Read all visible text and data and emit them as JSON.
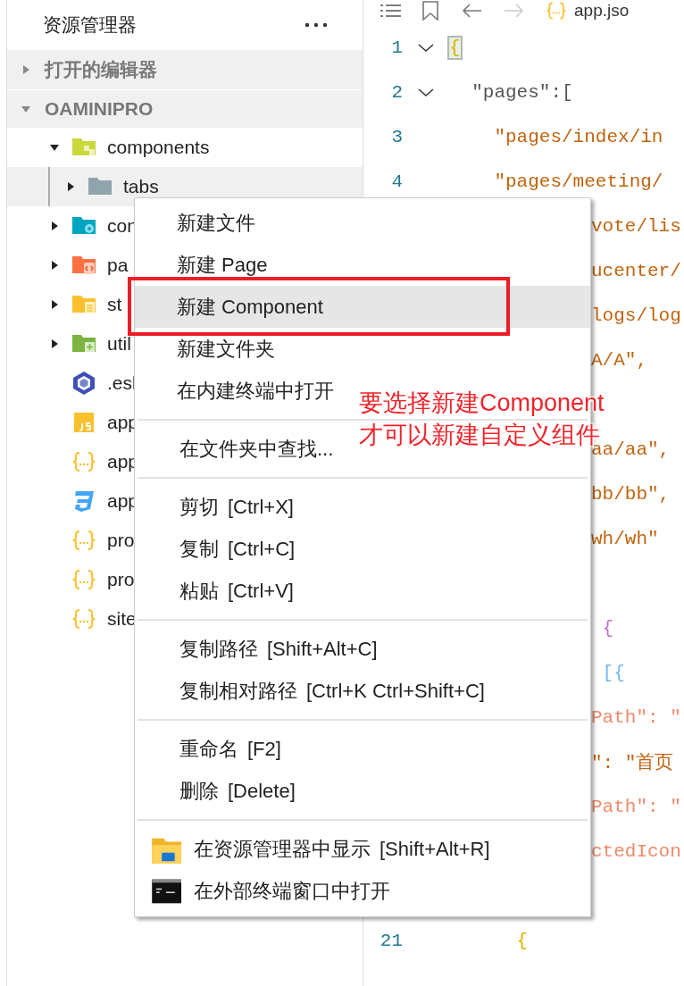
{
  "sidebar": {
    "title": "资源管理器",
    "sections": [
      {
        "title": "打开的编辑器",
        "expanded": false
      },
      {
        "title": "OAMINIPRO",
        "expanded": true,
        "items": [
          {
            "name": "components",
            "kind": "component-folder",
            "expanded": true,
            "selected": false,
            "children": [
              {
                "name": "tabs",
                "kind": "folder",
                "expanded": false,
                "selected": true
              }
            ]
          },
          {
            "name": "con",
            "kind": "config-folder",
            "expanded": false,
            "selected": false
          },
          {
            "name": "pa",
            "kind": "pages-folder",
            "expanded": false,
            "selected": false
          },
          {
            "name": "st",
            "kind": "static-folder",
            "expanded": false,
            "selected": false
          },
          {
            "name": "util",
            "kind": "utils-folder",
            "expanded": false,
            "selected": false
          },
          {
            "name": ".esl",
            "kind": "eslint-file",
            "selected": false
          },
          {
            "name": "app",
            "kind": "js-file",
            "selected": false
          },
          {
            "name": "app",
            "kind": "json-file",
            "selected": false
          },
          {
            "name": "app",
            "kind": "css-file",
            "selected": false
          },
          {
            "name": "pro",
            "kind": "json-file",
            "selected": false
          },
          {
            "name": "pro",
            "kind": "json-file",
            "selected": false
          },
          {
            "name": "site",
            "kind": "json-file",
            "selected": false
          }
        ]
      }
    ]
  },
  "editor": {
    "tab_label": "app.jso",
    "lines": [
      {
        "number": "1",
        "text": "{",
        "kind": "matched-brace",
        "foldable": true
      },
      {
        "number": "2",
        "text": "  \"pages\":[",
        "kind": "key",
        "foldable": true
      },
      {
        "number": "3",
        "text": "    \"pages/index/in",
        "kind": "string"
      },
      {
        "number": "4",
        "text": "    \"pages/meeting/",
        "kind": "string"
      },
      {
        "text": "vote/lis",
        "kind": "string"
      },
      {
        "text": "ucenter/",
        "kind": "string"
      },
      {
        "text": "logs/log",
        "kind": "string"
      },
      {
        "text": "A/A\",",
        "kind": "string"
      },
      {
        "kind": "blank"
      },
      {
        "text": "aa/aa\",",
        "kind": "string"
      },
      {
        "text": "bb/bb\",",
        "kind": "string"
      },
      {
        "text": "wh/wh\"",
        "kind": "string"
      },
      {
        "kind": "blank"
      },
      {
        "text": " {",
        "kind": "brace-purple"
      },
      {
        "text": " [{",
        "kind": "brace-blue"
      },
      {
        "text": "Path\": \"",
        "kind": "prop"
      },
      {
        "text": "\": \"首页",
        "kind": "string"
      },
      {
        "text": "Path\": \"",
        "kind": "prop"
      },
      {
        "text": "ctedIcon",
        "kind": "prop"
      },
      {
        "kind": "blank"
      },
      {
        "number": "21",
        "text": "      {",
        "kind": "brace-yellow"
      }
    ]
  },
  "context_menu": {
    "groups": [
      {
        "items": [
          {
            "label": "新建文件",
            "selected": false
          },
          {
            "label": "新建 Page",
            "selected": false
          },
          {
            "label": "新建 Component",
            "selected": true
          },
          {
            "label": "新建文件夹",
            "selected": false
          },
          {
            "label": "在内建终端中打开",
            "selected": false
          }
        ]
      },
      {
        "items": [
          {
            "label": "在文件夹中查找...",
            "selected": false
          }
        ]
      },
      {
        "items": [
          {
            "label": "剪切",
            "shortcut": "[Ctrl+X]",
            "selected": false
          },
          {
            "label": "复制",
            "shortcut": "[Ctrl+C]",
            "selected": false
          },
          {
            "label": "粘贴",
            "shortcut": "[Ctrl+V]",
            "selected": false
          }
        ]
      },
      {
        "items": [
          {
            "label": "复制路径",
            "shortcut": "[Shift+Alt+C]",
            "selected": false
          },
          {
            "label": "复制相对路径",
            "shortcut": "[Ctrl+K Ctrl+Shift+C]",
            "selected": false
          }
        ]
      },
      {
        "items": [
          {
            "label": "重命名",
            "shortcut": "[F2]",
            "selected": false
          },
          {
            "label": "删除",
            "shortcut": "[Delete]",
            "selected": false
          }
        ]
      },
      {
        "items": [
          {
            "label": "在资源管理器中显示",
            "shortcut": "[Shift+Alt+R]",
            "kind": "folder-item",
            "selected": false
          },
          {
            "label": "在外部终端窗口中打开",
            "kind": "terminal-item",
            "selected": false
          }
        ]
      }
    ]
  },
  "annotation": {
    "lines": [
      "要选择新建Component",
      "才可以新建自定义组件"
    ]
  }
}
